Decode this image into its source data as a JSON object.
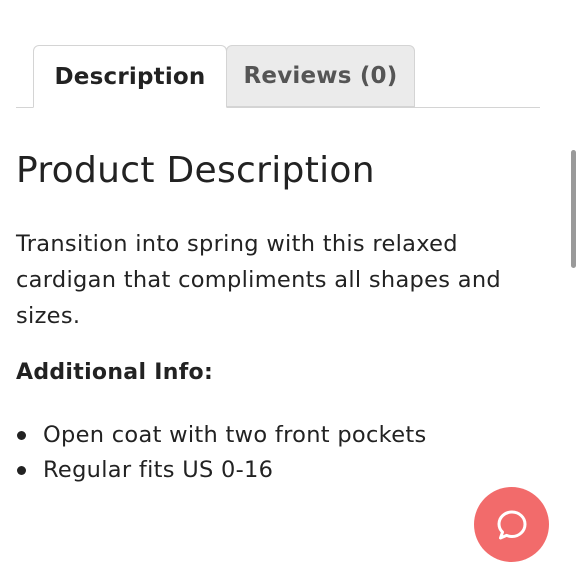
{
  "tabs": {
    "description_label": "Description",
    "reviews_label": "Reviews (0)"
  },
  "content": {
    "title": "Product Description",
    "description": "Transition into spring with this relaxed cardigan that compliments all shapes and sizes.",
    "additional_info_heading": "Additional Info:",
    "info_items": [
      "Open coat with two front pockets",
      "Regular fits US 0-16"
    ]
  },
  "chat": {
    "icon": "chat-bubble-icon",
    "color": "#f26b6b"
  }
}
